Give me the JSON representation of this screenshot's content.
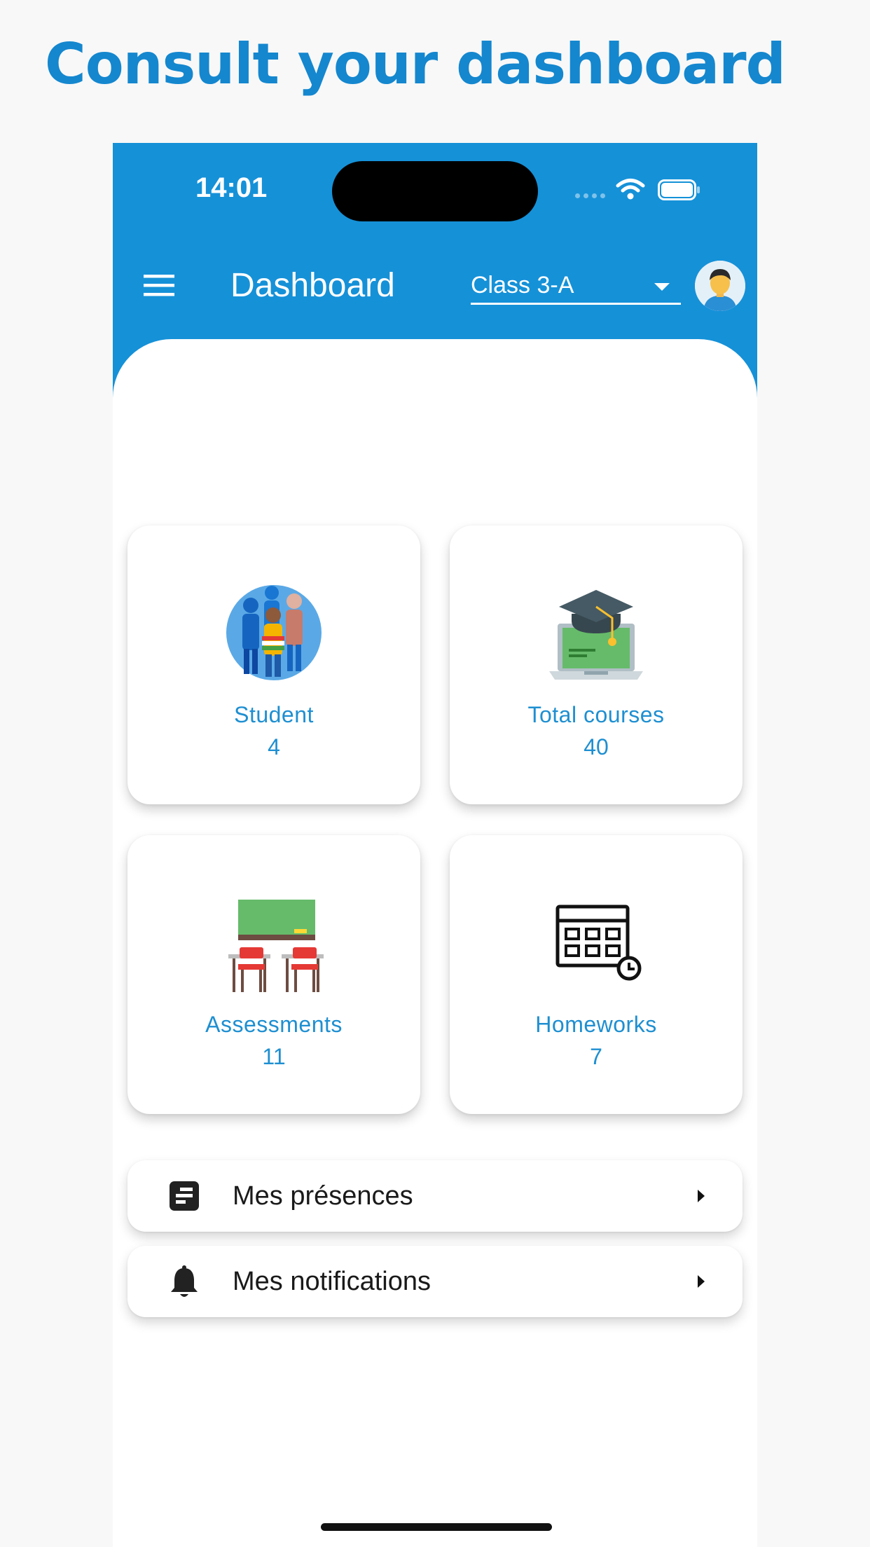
{
  "headline": "Consult your dashboard",
  "status_bar": {
    "time": "14:01"
  },
  "app_bar": {
    "title": "Dashboard",
    "class_select": {
      "value": "Class 3-A"
    }
  },
  "cards": [
    {
      "label": "Student",
      "count": "4",
      "icon": "students-group-icon"
    },
    {
      "label": "Total courses",
      "count": "40",
      "icon": "graduation-laptop-icon"
    },
    {
      "label": "Assessments",
      "count": "11",
      "icon": "classroom-desks-icon"
    },
    {
      "label": "Homeworks",
      "count": "7",
      "icon": "calendar-clock-icon"
    }
  ],
  "list": [
    {
      "label": "Mes présences",
      "icon": "attendance-icon"
    },
    {
      "label": "Mes notifications",
      "icon": "bell-icon"
    }
  ],
  "colors": {
    "primary": "#1591d8",
    "accent_text": "#1e8fd1",
    "headline": "#1487cf"
  }
}
